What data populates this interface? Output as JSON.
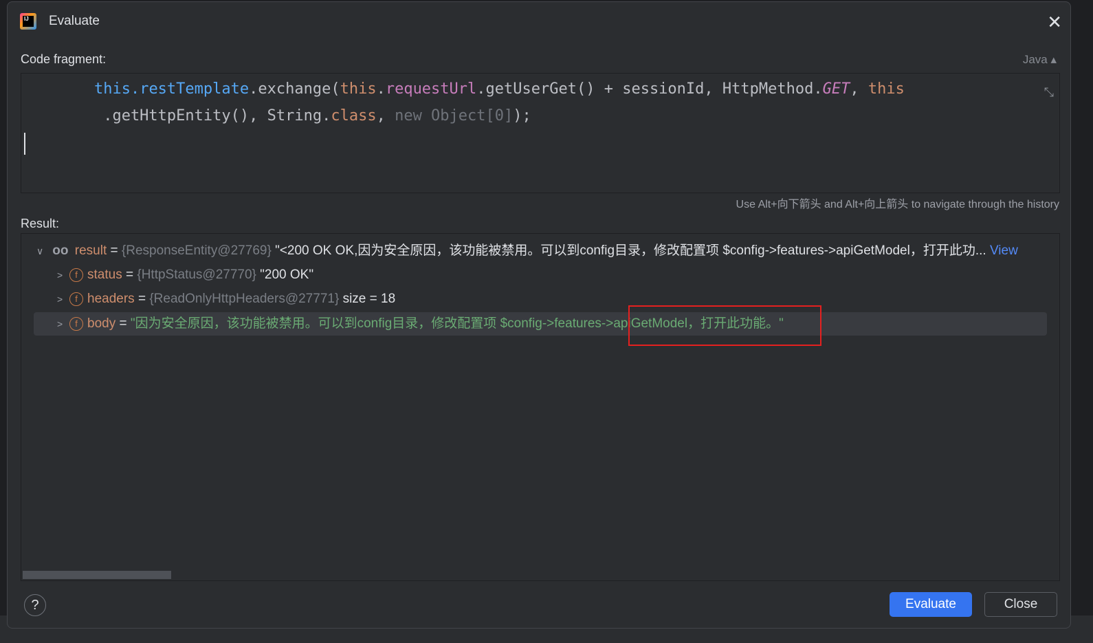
{
  "dialog": {
    "title": "Evaluate",
    "close_icon": "close-icon"
  },
  "code": {
    "label": "Code fragment:",
    "language": "Java",
    "line1": [
      {
        "t": "        "
      },
      {
        "t": "this.restTemplate",
        "c": "blu"
      },
      {
        "t": ".exchange("
      },
      {
        "t": "this",
        "c": "kw"
      },
      {
        "t": "."
      },
      {
        "t": "requestUrl",
        "c": "fld"
      },
      {
        "t": ".getUserGet() + sessionId, HttpMethod."
      },
      {
        "t": "GET",
        "c": "it"
      },
      {
        "t": ", "
      },
      {
        "t": "this",
        "c": "kw"
      }
    ],
    "line2": [
      {
        "t": "         .getHttpEntity(), String."
      },
      {
        "t": "class",
        "c": "kw"
      },
      {
        "t": ", "
      },
      {
        "t": "new Object[0]",
        "c": "gr"
      },
      {
        "t": ");"
      }
    ],
    "history_hint": "Use Alt+向下箭头 and Alt+向上箭头 to navigate through the history"
  },
  "result": {
    "label": "Result:",
    "root": {
      "name": "result",
      "eq": " = ",
      "type": "{ResponseEntity@27769}",
      "value": " \"<200 OK OK,因为安全原因，该功能被禁用。可以到config目录，修改配置项 $config->features->apiGetModel，打开此功...",
      "view": " View"
    },
    "children": [
      {
        "name": "status",
        "eq": " = ",
        "type": "{HttpStatus@27770}",
        "value": " \"200 OK\""
      },
      {
        "name": "headers",
        "eq": " = ",
        "type": "{ReadOnlyHttpHeaders@27771}",
        "value": "  size = 18"
      },
      {
        "name": "body",
        "eq": " = ",
        "type": "",
        "value": "\"因为安全原因，该功能被禁用。可以到config目录，修改配置项 $config->features->apiGetModel，打开此功能。\""
      }
    ]
  },
  "buttons": {
    "evaluate": "Evaluate",
    "close": "Close",
    "help": "?"
  }
}
